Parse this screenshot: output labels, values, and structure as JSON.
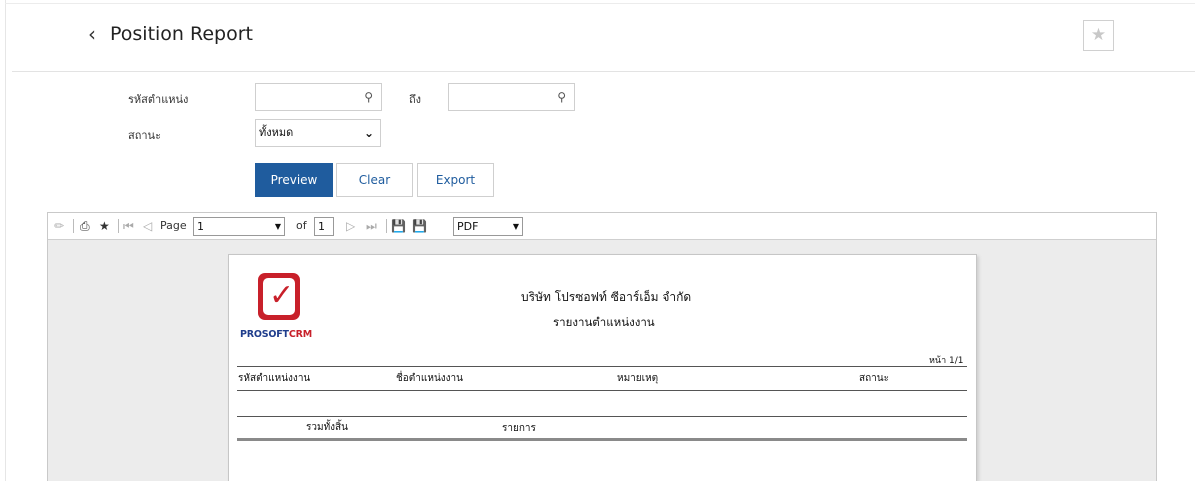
{
  "header": {
    "back_icon": "chevron-left-icon",
    "title": "Position Report",
    "favorite_icon": "star-icon"
  },
  "form": {
    "position_code_label": "รหัสตำแหน่ง",
    "to_label": "ถึง",
    "status_label": "สถานะ",
    "status_selected": "ทั้งหมด",
    "position_from_value": "",
    "position_to_value": "",
    "preview_label": "Preview",
    "clear_label": "Clear",
    "export_label": "Export"
  },
  "viewer": {
    "page_label": "Page",
    "page_value": "1",
    "of_label": "of",
    "total_pages": "1",
    "format_value": "PDF"
  },
  "report": {
    "company_name": "บริษัท โปรซอฟท์ ซีอาร์เอ็ม จำกัด",
    "report_title": "รายงานตำแหน่งงาน",
    "page_info": "หน้า 1/1",
    "logo_text_a": "PROSOFT",
    "logo_text_b": "CRM",
    "columns": [
      "รหัสตำแหน่งงาน",
      "ชื่อตำแหน่งงาน",
      "หมายเหตุ",
      "สถานะ"
    ],
    "total_label": "รวมทั้งสิ้น",
    "items_label": "รายการ"
  },
  "colors": {
    "primary": "#1f5c9e",
    "logo_red": "#c8202a",
    "logo_blue": "#1f3d8c"
  }
}
